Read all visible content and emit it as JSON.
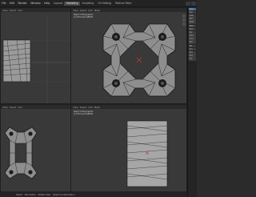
{
  "menu": [
    "File",
    "Edit",
    "Render",
    "Window",
    "Help"
  ],
  "tabs": [
    {
      "label": "Layout",
      "active": false
    },
    {
      "label": "Modeling",
      "active": true
    },
    {
      "label": "Sculpting",
      "active": false
    },
    {
      "label": "UV Editing",
      "active": false
    },
    {
      "label": "Texture Paint",
      "active": false
    },
    {
      "label": "Shading",
      "active": false
    }
  ],
  "viewports": {
    "top_left": {
      "header": [
        "View",
        "Select",
        "Add"
      ]
    },
    "top_right": {
      "header": [
        "View",
        "Select",
        "Add",
        "Mesh"
      ],
      "info": [
        "Right Orthographic",
        "(1) Extrusion|8020"
      ]
    },
    "bottom_left": {
      "header": [
        "View",
        "Select",
        "Add"
      ]
    },
    "bottom_right": {
      "header": [
        "View",
        "Select",
        "Add",
        "Mesh"
      ],
      "info": [
        "Right Orthographic",
        "(1) Extrusion|8020"
      ]
    }
  },
  "side_panel_rows": [
    "Item",
    "Tool",
    "View",
    "Edit",
    "Mesh",
    "Data",
    "Mod",
    "Obj",
    "Phys",
    "Cons",
    "Mat",
    "Tex",
    "Scn",
    "Wld",
    "Rnd",
    "Out"
  ],
  "statusbar": [
    "Select",
    "Box Select",
    "Rotate View",
    "Object Context Menu"
  ],
  "colors": {
    "viewport_bg": "#393939",
    "mesh_fill": "#8e8e8e",
    "mesh_edge": "#161616",
    "accent": "#3f6ea8"
  }
}
